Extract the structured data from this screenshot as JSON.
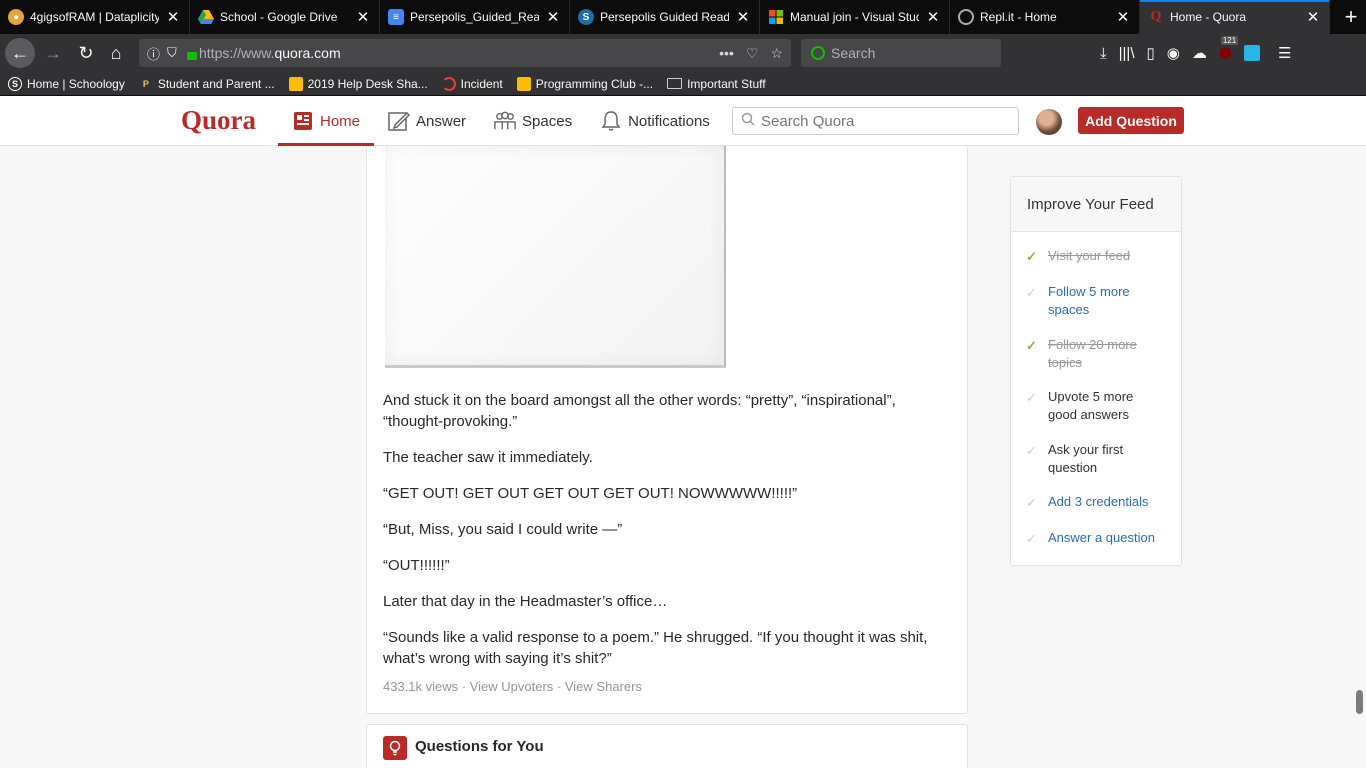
{
  "browser": {
    "tabs": [
      {
        "title": "4gigsofRAM | Dataplicity",
        "icon": "dataplicity-icon",
        "color": "#e8a33c"
      },
      {
        "title": "School - Google Drive",
        "icon": "google-drive-icon",
        "color": "#1fa463"
      },
      {
        "title": "Persepolis_Guided_Readi",
        "icon": "google-docs-icon",
        "color": "#4285f4"
      },
      {
        "title": "Persepolis Guided Readi",
        "icon": "schoology-icon",
        "color": "#1f6ca6"
      },
      {
        "title": "Manual join - Visual Stud",
        "icon": "microsoft-icon",
        "color": "#f25022"
      },
      {
        "title": "Repl.it - Home",
        "icon": "replit-icon",
        "color": "#8a8a8a"
      },
      {
        "title": "Home - Quora",
        "icon": "quora-icon",
        "color": "#b92b27"
      }
    ],
    "url_prefix": "https://www.",
    "url_domain": "quora.com",
    "search_placeholder": "Search",
    "badge_count": "121",
    "bookmarks": [
      {
        "label": "Home | Schoology",
        "icon": "schoology-icon"
      },
      {
        "label": "Student and Parent ...",
        "icon": "p-icon"
      },
      {
        "label": "2019 Help Desk Sha...",
        "icon": "google-drive-icon"
      },
      {
        "label": "Incident",
        "icon": "servicenow-icon"
      },
      {
        "label": "Programming Club -...",
        "icon": "google-drive-icon"
      },
      {
        "label": "Important Stuff",
        "icon": "folder-icon"
      }
    ]
  },
  "quora": {
    "logo": "Quora",
    "nav": {
      "home": "Home",
      "answer": "Answer",
      "spaces": "Spaces",
      "notifications": "Notifications"
    },
    "search_placeholder": "Search Quora",
    "add_question": "Add Question",
    "accent_color": "#b92b27"
  },
  "answer": {
    "paragraphs": [
      "And stuck it on the board amongst all the other words: “pretty”, “inspirational”, “thought-provoking.”",
      "The teacher saw it immediately.",
      "“GET OUT! GET OUT GET OUT GET OUT! NOWWWWW!!!!!”",
      "“But, Miss, you said I could write —”",
      "“OUT!!!!!!”",
      "Later that day in the Headmaster’s office…",
      "“Sounds like a valid response to a poem.” He shrugged. “If you thought it was shit, what’s wrong with saying it’s shit?”"
    ],
    "views": "433.1k views",
    "sep": " · ",
    "view_upvoters": "View Upvoters",
    "view_sharers": "View Sharers"
  },
  "questions_for_you": {
    "title": "Questions for You"
  },
  "sidebar": {
    "title": "Improve Your Feed",
    "tasks": [
      {
        "label": "Visit your feed",
        "state": "done"
      },
      {
        "label": "Follow 5 more spaces",
        "state": "link"
      },
      {
        "label": "Follow 20 more topics",
        "state": "done"
      },
      {
        "label": "Upvote 5 more good answers",
        "state": "todo"
      },
      {
        "label": "Ask your first question",
        "state": "todo"
      },
      {
        "label": "Add 3 credentials",
        "state": "link"
      },
      {
        "label": "Answer a question",
        "state": "link"
      }
    ]
  }
}
